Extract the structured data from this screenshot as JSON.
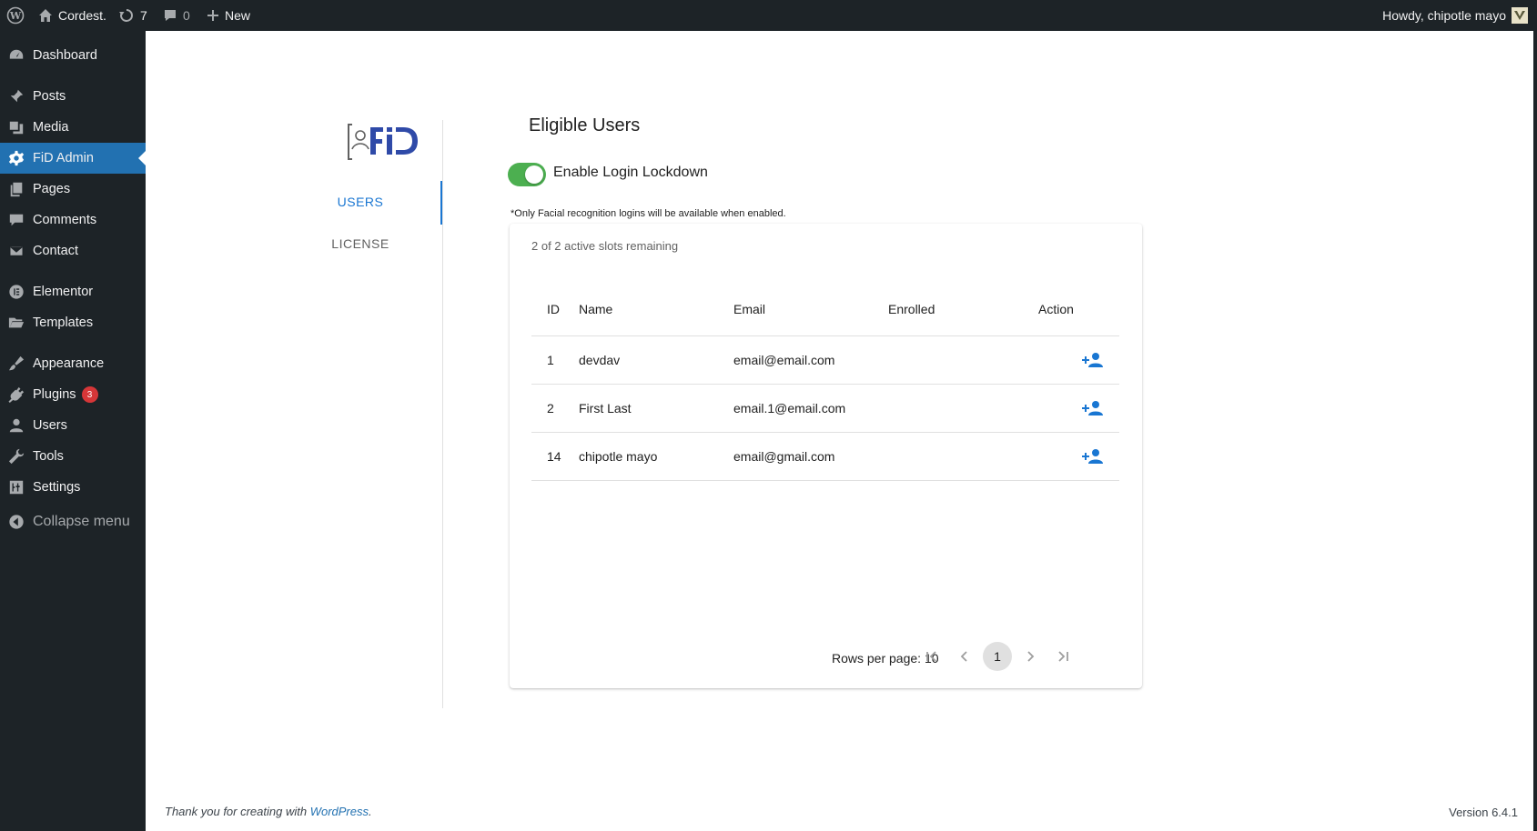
{
  "adminbar": {
    "site_name": "Cordest.",
    "updates_count": "7",
    "comments_count": "0",
    "new_label": "New",
    "howdy": "Howdy, chipotle mayo"
  },
  "sidebar": {
    "items": [
      {
        "label": "Dashboard",
        "icon": "dashboard-icon"
      },
      {
        "label": "Posts",
        "icon": "pin-icon"
      },
      {
        "label": "Media",
        "icon": "media-icon"
      },
      {
        "label": "FiD Admin",
        "icon": "gear-icon"
      },
      {
        "label": "Pages",
        "icon": "pages-icon"
      },
      {
        "label": "Comments",
        "icon": "comment-icon"
      },
      {
        "label": "Contact",
        "icon": "mail-icon"
      },
      {
        "label": "Elementor",
        "icon": "elementor-icon"
      },
      {
        "label": "Templates",
        "icon": "folder-icon"
      },
      {
        "label": "Appearance",
        "icon": "brush-icon"
      },
      {
        "label": "Plugins",
        "icon": "plugin-icon",
        "badge": "3"
      },
      {
        "label": "Users",
        "icon": "user-icon"
      },
      {
        "label": "Tools",
        "icon": "wrench-icon"
      },
      {
        "label": "Settings",
        "icon": "settings-icon"
      }
    ],
    "collapse_label": "Collapse menu"
  },
  "fid": {
    "tabs": [
      "USERS",
      "LICENSE"
    ]
  },
  "main": {
    "title": "Eligible Users",
    "toggle_label": "Enable Login Lockdown",
    "toggle_on": true,
    "note": "*Only Facial recognition logins will be available when enabled.",
    "slots": "2 of 2 active slots remaining",
    "table": {
      "headers": [
        "ID",
        "Name",
        "Email",
        "Enrolled",
        "Action"
      ],
      "rows": [
        {
          "id": "1",
          "name": "devdav",
          "email": "email@email.com",
          "enrolled": ""
        },
        {
          "id": "2",
          "name": "First Last",
          "email": "email.1@email.com",
          "enrolled": ""
        },
        {
          "id": "14",
          "name": "chipotle mayo",
          "email": "email@gmail.com",
          "enrolled": ""
        }
      ]
    },
    "pagination": {
      "rows_per_page": "Rows per page: 10",
      "current_page": "1"
    }
  },
  "footer": {
    "thanks_prefix": "Thank you for creating with",
    "wp_link": "WordPress",
    "thanks_suffix": ".",
    "version": "Version 6.4.1"
  },
  "colors": {
    "wp_dark": "#1d2327",
    "wp_blue": "#2271b1",
    "mui_blue": "#1976d2",
    "toggle_green": "#4caf50",
    "badge_red": "#d63638"
  }
}
